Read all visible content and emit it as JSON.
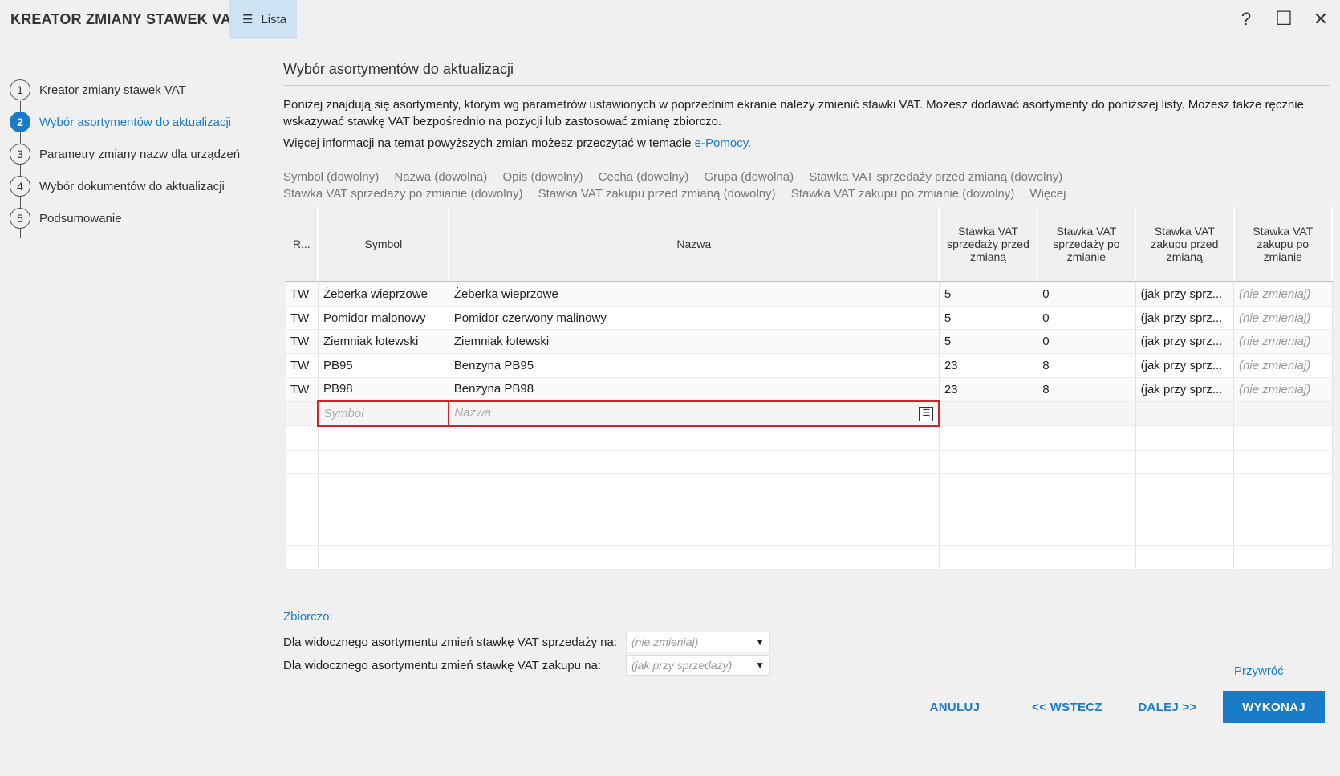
{
  "window": {
    "title": "KREATOR ZMIANY STAWEK VAT",
    "view_button": "Lista",
    "help": "?",
    "maximize": "☐",
    "close": "✕"
  },
  "steps": [
    {
      "num": "1",
      "label": "Kreator zmiany stawek VAT"
    },
    {
      "num": "2",
      "label": "Wybór asortymentów do aktualizacji"
    },
    {
      "num": "3",
      "label": "Parametry zmiany nazw dla urządzeń"
    },
    {
      "num": "4",
      "label": "Wybór dokumentów do aktualizacji"
    },
    {
      "num": "5",
      "label": "Podsumowanie"
    }
  ],
  "main": {
    "title": "Wybór asortymentów do aktualizacji",
    "description": "Poniżej znajdują się asortymenty, którym wg parametrów ustawionych w poprzednim ekranie należy zmienić stawki VAT. Możesz dodawać asortymenty do poniższej listy. Możesz także ręcznie wskazywać stawkę VAT bezpośrednio na pozycji lub zastosować zmianę zbiorczo.",
    "more_info_prefix": "Więcej informacji na temat powyższych zmian możesz przeczytać w temacie",
    "more_info_link": "e-Pomocy."
  },
  "filters": [
    "Symbol (dowolny)",
    "Nazwa (dowolna)",
    "Opis (dowolny)",
    "Cecha (dowolny)",
    "Grupa (dowolna)",
    "Stawka VAT sprzedaży przed zmianą (dowolny)",
    "Stawka VAT sprzedaży po zmianie (dowolny)",
    "Stawka VAT zakupu przed zmianą (dowolny)",
    "Stawka VAT zakupu po zmianie (dowolny)",
    "Więcej"
  ],
  "table": {
    "headers": [
      "R...",
      "Symbol",
      "Nazwa",
      "Stawka VAT sprzedaży przed zmianą",
      "Stawka VAT sprzedaży po zmianie",
      "Stawka VAT zakupu przed zmianą",
      "Stawka VAT zakupu po zmianie"
    ],
    "rows": [
      [
        "TW",
        "Żeberka wieprzowe",
        "Żeberka wieprzowe",
        "5",
        "0",
        "(jak przy sprz...",
        "(nie zmieniaj)"
      ],
      [
        "TW",
        "Pomidor malonowy",
        "Pomidor czerwony malinowy",
        "5",
        "0",
        "(jak przy sprz...",
        "(nie zmieniaj)"
      ],
      [
        "TW",
        "Ziemniak łotewski",
        "Ziemniak łotewski",
        "5",
        "0",
        "(jak przy sprz...",
        "(nie zmieniaj)"
      ],
      [
        "TW",
        "PB95",
        "Benzyna PB95",
        "23",
        "8",
        "(jak przy sprz...",
        "(nie zmieniaj)"
      ],
      [
        "TW",
        "PB98",
        "Benzyna PB98",
        "23",
        "8",
        "(jak przy sprz...",
        "(nie zmieniaj)"
      ]
    ],
    "new_row": {
      "symbol_placeholder": "Symbol",
      "name_placeholder": "Nazwa",
      "picker": "☰"
    }
  },
  "bulk": {
    "title": "Zbiorczo:",
    "sale_label": "Dla widocznego asortymentu zmień stawkę VAT sprzedaży na:",
    "sale_value": "(nie zmieniaj)",
    "purchase_label": "Dla widocznego asortymentu zmień stawkę VAT zakupu na:",
    "purchase_value": "(jak przy sprzedaży)",
    "restore": "Przywróć"
  },
  "footer": {
    "cancel": "ANULUJ",
    "back": "<< WSTECZ",
    "next": "DALEJ >>",
    "execute": "WYKONAJ"
  },
  "colors": {
    "accent": "#1a7bc7",
    "highlight": "#cde3f4",
    "error": "#d2232a"
  }
}
